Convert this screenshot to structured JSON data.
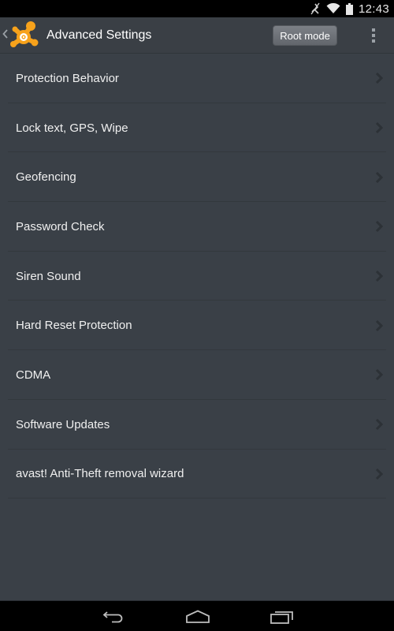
{
  "status_bar": {
    "icons": [
      "mute-icon",
      "wifi-icon",
      "battery-icon"
    ],
    "time": "12:43"
  },
  "action_bar": {
    "up_icon": "chevron-left-icon",
    "logo_icon": "avast-logo-icon",
    "title": "Advanced Settings",
    "root_mode_label": "Root mode",
    "overflow_icon": "more-vert-icon"
  },
  "settings": {
    "items": [
      {
        "label": "Protection Behavior"
      },
      {
        "label": "Lock text, GPS, Wipe"
      },
      {
        "label": "Geofencing"
      },
      {
        "label": "Password Check"
      },
      {
        "label": "Siren Sound"
      },
      {
        "label": "Hard Reset Protection"
      },
      {
        "label": "CDMA"
      },
      {
        "label": "Software Updates"
      },
      {
        "label": "avast! Anti-Theft removal wizard"
      }
    ],
    "chevron_icon": "chevron-right-icon"
  },
  "nav_bar": {
    "buttons": [
      "back-icon",
      "home-icon",
      "recents-icon"
    ]
  },
  "colors": {
    "background": "#3a4047",
    "accent_orange": "#f7a21b",
    "button_gray": "#6e7278"
  }
}
